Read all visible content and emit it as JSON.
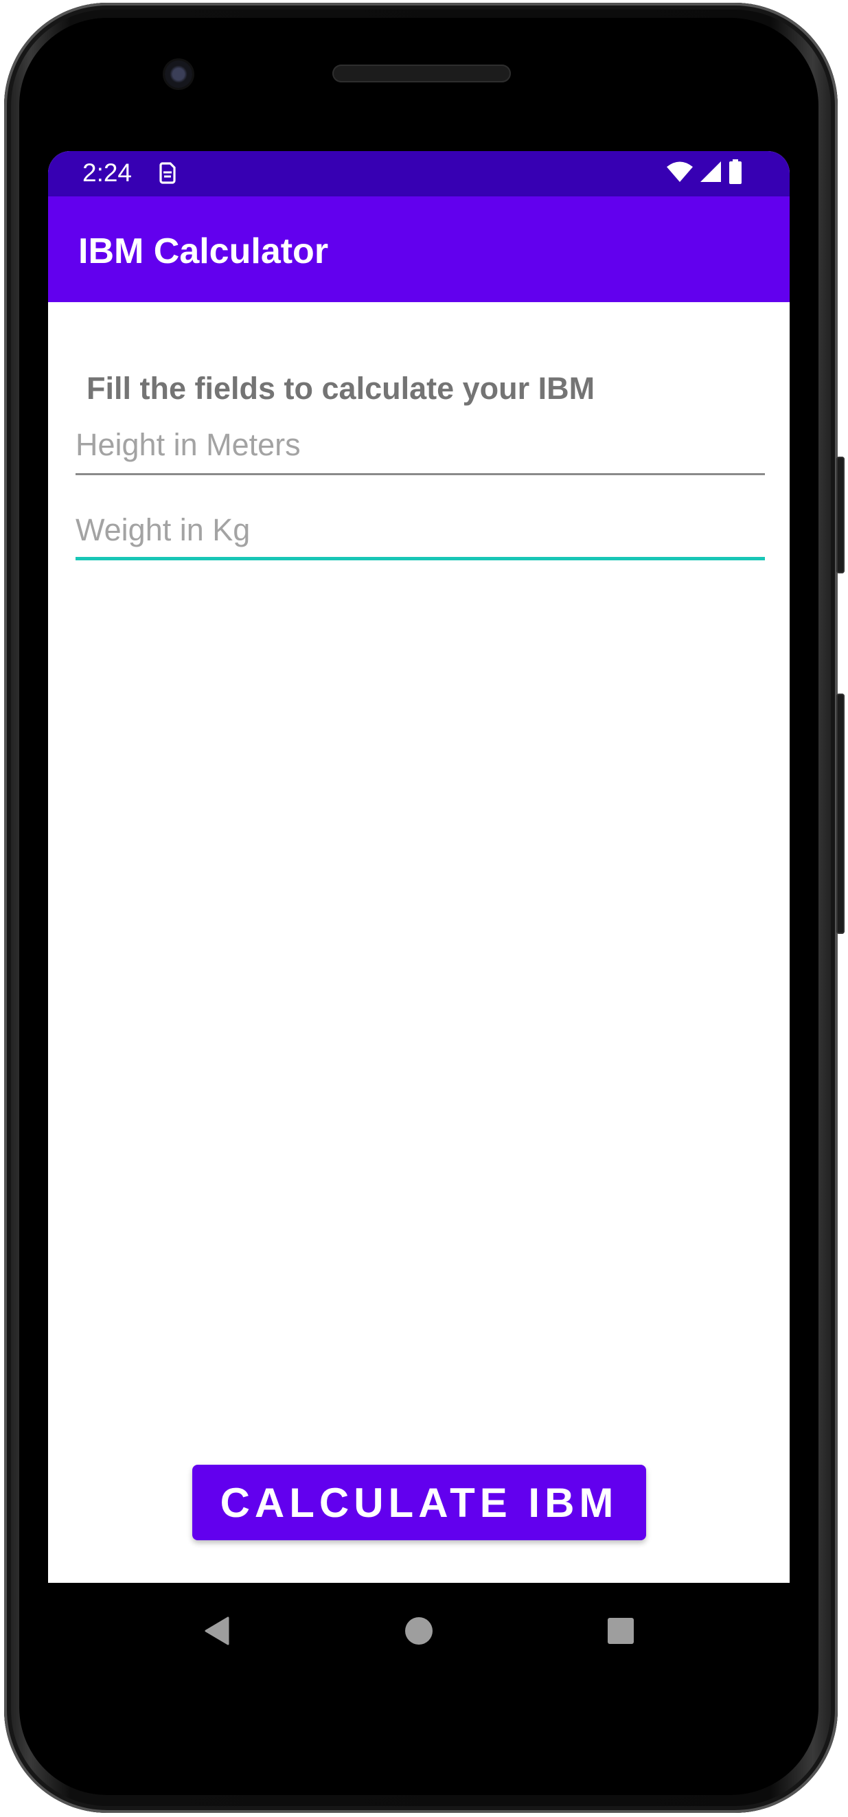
{
  "status_bar": {
    "time": "2:24",
    "notification_icon": "sim-card-icon",
    "right_icons": [
      "wifi-icon",
      "cell-signal-icon",
      "battery-icon"
    ],
    "color": "#3700b3"
  },
  "app_bar": {
    "title": "IBM Calculator",
    "color": "#6200ee"
  },
  "main": {
    "instructions": "Fill the fields to calculate your IBM",
    "height_field": {
      "placeholder": "Height in Meters",
      "value": ""
    },
    "weight_field": {
      "placeholder": "Weight in Kg",
      "value": "",
      "focused": true,
      "accent_color": "#18c6b6"
    },
    "calculate_button": {
      "label": "CALCULATE IBM",
      "color": "#6200ee"
    }
  },
  "nav_bar": {
    "buttons": [
      "back-icon",
      "home-icon",
      "recents-icon"
    ]
  }
}
